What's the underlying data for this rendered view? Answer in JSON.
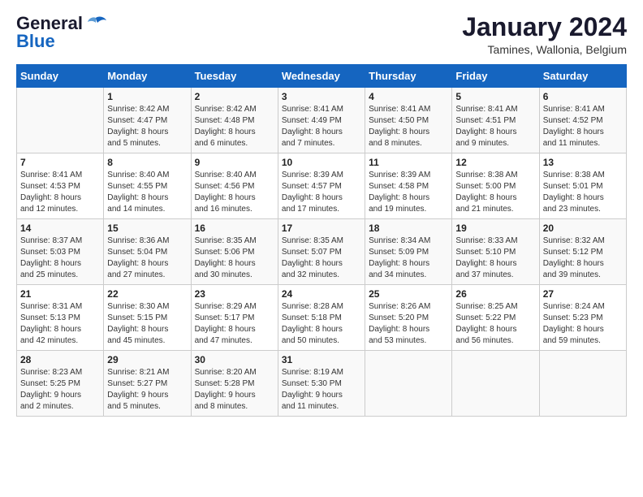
{
  "header": {
    "logo": {
      "line1": "General",
      "line2": "Blue"
    },
    "title": "January 2024",
    "location": "Tamines, Wallonia, Belgium"
  },
  "days_of_week": [
    "Sunday",
    "Monday",
    "Tuesday",
    "Wednesday",
    "Thursday",
    "Friday",
    "Saturday"
  ],
  "weeks": [
    [
      {
        "day": "",
        "info": ""
      },
      {
        "day": "1",
        "info": "Sunrise: 8:42 AM\nSunset: 4:47 PM\nDaylight: 8 hours\nand 5 minutes."
      },
      {
        "day": "2",
        "info": "Sunrise: 8:42 AM\nSunset: 4:48 PM\nDaylight: 8 hours\nand 6 minutes."
      },
      {
        "day": "3",
        "info": "Sunrise: 8:41 AM\nSunset: 4:49 PM\nDaylight: 8 hours\nand 7 minutes."
      },
      {
        "day": "4",
        "info": "Sunrise: 8:41 AM\nSunset: 4:50 PM\nDaylight: 8 hours\nand 8 minutes."
      },
      {
        "day": "5",
        "info": "Sunrise: 8:41 AM\nSunset: 4:51 PM\nDaylight: 8 hours\nand 9 minutes."
      },
      {
        "day": "6",
        "info": "Sunrise: 8:41 AM\nSunset: 4:52 PM\nDaylight: 8 hours\nand 11 minutes."
      }
    ],
    [
      {
        "day": "7",
        "info": "Sunrise: 8:41 AM\nSunset: 4:53 PM\nDaylight: 8 hours\nand 12 minutes."
      },
      {
        "day": "8",
        "info": "Sunrise: 8:40 AM\nSunset: 4:55 PM\nDaylight: 8 hours\nand 14 minutes."
      },
      {
        "day": "9",
        "info": "Sunrise: 8:40 AM\nSunset: 4:56 PM\nDaylight: 8 hours\nand 16 minutes."
      },
      {
        "day": "10",
        "info": "Sunrise: 8:39 AM\nSunset: 4:57 PM\nDaylight: 8 hours\nand 17 minutes."
      },
      {
        "day": "11",
        "info": "Sunrise: 8:39 AM\nSunset: 4:58 PM\nDaylight: 8 hours\nand 19 minutes."
      },
      {
        "day": "12",
        "info": "Sunrise: 8:38 AM\nSunset: 5:00 PM\nDaylight: 8 hours\nand 21 minutes."
      },
      {
        "day": "13",
        "info": "Sunrise: 8:38 AM\nSunset: 5:01 PM\nDaylight: 8 hours\nand 23 minutes."
      }
    ],
    [
      {
        "day": "14",
        "info": "Sunrise: 8:37 AM\nSunset: 5:03 PM\nDaylight: 8 hours\nand 25 minutes."
      },
      {
        "day": "15",
        "info": "Sunrise: 8:36 AM\nSunset: 5:04 PM\nDaylight: 8 hours\nand 27 minutes."
      },
      {
        "day": "16",
        "info": "Sunrise: 8:35 AM\nSunset: 5:06 PM\nDaylight: 8 hours\nand 30 minutes."
      },
      {
        "day": "17",
        "info": "Sunrise: 8:35 AM\nSunset: 5:07 PM\nDaylight: 8 hours\nand 32 minutes."
      },
      {
        "day": "18",
        "info": "Sunrise: 8:34 AM\nSunset: 5:09 PM\nDaylight: 8 hours\nand 34 minutes."
      },
      {
        "day": "19",
        "info": "Sunrise: 8:33 AM\nSunset: 5:10 PM\nDaylight: 8 hours\nand 37 minutes."
      },
      {
        "day": "20",
        "info": "Sunrise: 8:32 AM\nSunset: 5:12 PM\nDaylight: 8 hours\nand 39 minutes."
      }
    ],
    [
      {
        "day": "21",
        "info": "Sunrise: 8:31 AM\nSunset: 5:13 PM\nDaylight: 8 hours\nand 42 minutes."
      },
      {
        "day": "22",
        "info": "Sunrise: 8:30 AM\nSunset: 5:15 PM\nDaylight: 8 hours\nand 45 minutes."
      },
      {
        "day": "23",
        "info": "Sunrise: 8:29 AM\nSunset: 5:17 PM\nDaylight: 8 hours\nand 47 minutes."
      },
      {
        "day": "24",
        "info": "Sunrise: 8:28 AM\nSunset: 5:18 PM\nDaylight: 8 hours\nand 50 minutes."
      },
      {
        "day": "25",
        "info": "Sunrise: 8:26 AM\nSunset: 5:20 PM\nDaylight: 8 hours\nand 53 minutes."
      },
      {
        "day": "26",
        "info": "Sunrise: 8:25 AM\nSunset: 5:22 PM\nDaylight: 8 hours\nand 56 minutes."
      },
      {
        "day": "27",
        "info": "Sunrise: 8:24 AM\nSunset: 5:23 PM\nDaylight: 8 hours\nand 59 minutes."
      }
    ],
    [
      {
        "day": "28",
        "info": "Sunrise: 8:23 AM\nSunset: 5:25 PM\nDaylight: 9 hours\nand 2 minutes."
      },
      {
        "day": "29",
        "info": "Sunrise: 8:21 AM\nSunset: 5:27 PM\nDaylight: 9 hours\nand 5 minutes."
      },
      {
        "day": "30",
        "info": "Sunrise: 8:20 AM\nSunset: 5:28 PM\nDaylight: 9 hours\nand 8 minutes."
      },
      {
        "day": "31",
        "info": "Sunrise: 8:19 AM\nSunset: 5:30 PM\nDaylight: 9 hours\nand 11 minutes."
      },
      {
        "day": "",
        "info": ""
      },
      {
        "day": "",
        "info": ""
      },
      {
        "day": "",
        "info": ""
      }
    ]
  ]
}
